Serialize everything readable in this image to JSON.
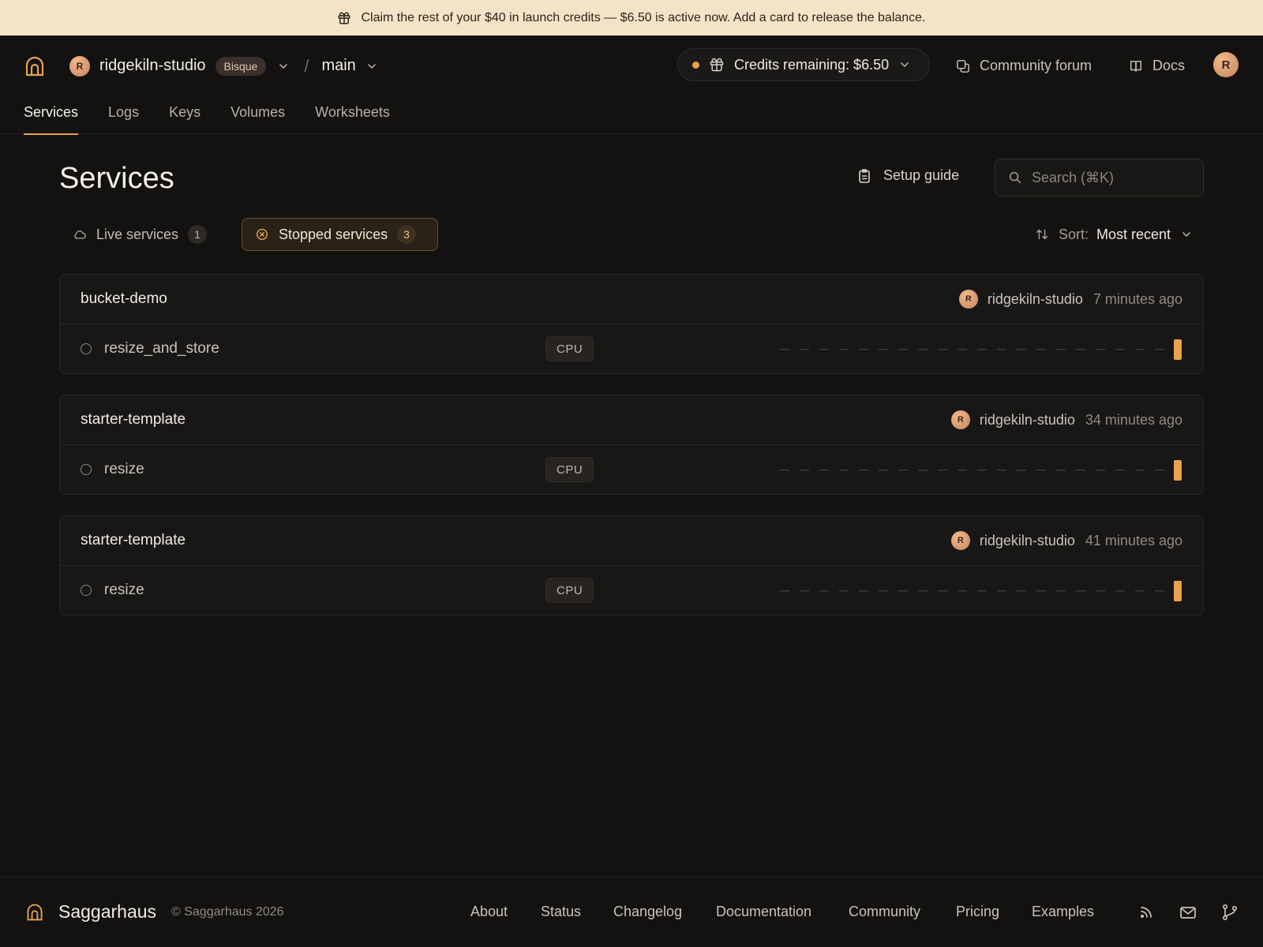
{
  "banner": {
    "text": "Claim the rest of your $40 in launch credits — $6.50 is active now. Add a card to release the balance."
  },
  "header": {
    "org_avatar": "R",
    "org_name": "ridgekiln-studio",
    "plan": "Bisque",
    "separator": "/",
    "branch": "main",
    "credits_label": "Credits remaining: $6.50",
    "community_label": "Community forum",
    "docs_label": "Docs",
    "user_avatar": "R"
  },
  "nav": {
    "tabs": [
      "Services",
      "Logs",
      "Keys",
      "Volumes",
      "Worksheets"
    ],
    "active": "Services"
  },
  "main": {
    "title": "Services",
    "setup_label": "Setup guide",
    "search_placeholder": "Search (⌘K)",
    "filters": {
      "live_label": "Live services",
      "live_count": "1",
      "stopped_label": "Stopped services",
      "stopped_count": "3"
    },
    "sort_label": "Sort:",
    "sort_value": "Most recent"
  },
  "services": [
    {
      "name": "bucket-demo",
      "owner_avatar": "R",
      "owner": "ridgekiln-studio",
      "updated": "7 minutes ago",
      "function": "resize_and_store",
      "resource": "CPU",
      "activity_last": 1
    },
    {
      "name": "starter-template",
      "owner_avatar": "R",
      "owner": "ridgekiln-studio",
      "updated": "34 minutes ago",
      "function": "resize",
      "resource": "CPU",
      "activity_last": 1
    },
    {
      "name": "starter-template",
      "owner_avatar": "R",
      "owner": "ridgekiln-studio",
      "updated": "41 minutes ago",
      "function": "resize",
      "resource": "CPU",
      "activity_last": 1
    }
  ],
  "footer": {
    "brand": "Saggarhaus",
    "copyright": "© Saggarhaus 2026",
    "links": [
      "About",
      "Status",
      "Changelog",
      "Documentation",
      "Community",
      "Pricing",
      "Examples"
    ]
  },
  "colors": {
    "accent": "#e8a24e",
    "banner_bg": "#f4e3c6",
    "page_bg": "#131211"
  }
}
